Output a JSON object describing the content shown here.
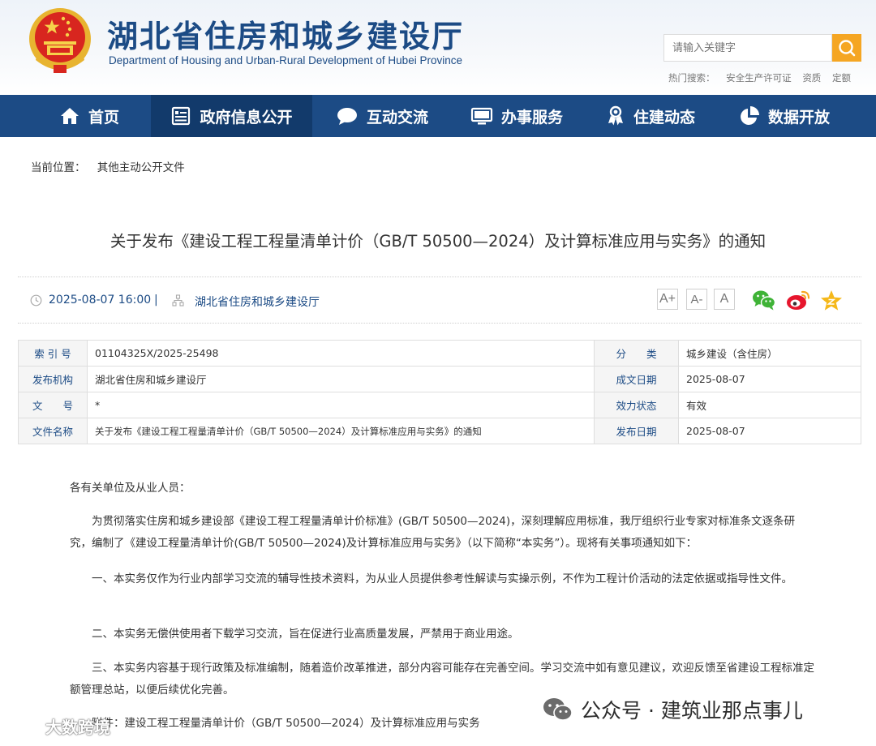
{
  "header": {
    "title": "湖北省住房和城乡建设厅",
    "subtitle": "Department of Housing and Urban-Rural Development of Hubei Province",
    "search_placeholder": "请输入关键字",
    "hot_search_label": "热门搜索：",
    "hot_search_items": [
      "安全生产许可证",
      "资质",
      "定额"
    ]
  },
  "nav": {
    "items": [
      {
        "label": "首页",
        "icon": "home-icon"
      },
      {
        "label": "政府信息公开",
        "icon": "document-list-icon"
      },
      {
        "label": "互动交流",
        "icon": "chat-bubble-icon"
      },
      {
        "label": "办事服务",
        "icon": "monitor-icon"
      },
      {
        "label": "住建动态",
        "icon": "award-person-icon"
      },
      {
        "label": "数据开放",
        "icon": "pie-chart-icon"
      }
    ],
    "active_index": 1
  },
  "breadcrumb": {
    "label": "当前位置：",
    "current": "其他主动公开文件"
  },
  "article": {
    "title": "关于发布《建设工程工程量清单计价（GB/T 50500—2024）及计算标准应用与实务》的通知",
    "date": "2025-08-07 16:00",
    "separator": "|",
    "publisher": "湖北省住房和城乡建设厅",
    "font_sizes": [
      "A+",
      "A-",
      "A"
    ]
  },
  "info_table": {
    "rows": [
      {
        "label1": "索 引 号",
        "value1": "01104325X/2025-25498",
        "label2": "分　　类",
        "value2": "城乡建设（含住房）"
      },
      {
        "label1": "发布机构",
        "value1": "湖北省住房和城乡建设厅",
        "label2": "成文日期",
        "value2": "2025-08-07"
      },
      {
        "label1": "文　　号",
        "value1": "*",
        "label2": "效力状态",
        "value2": "有效"
      },
      {
        "label1": "文件名称",
        "value1": "关于发布《建设工程工程量清单计价（GB/T 50500—2024）及计算标准应用与实务》的通知",
        "label2": "发布日期",
        "value2": "2025-08-07"
      }
    ]
  },
  "body": {
    "salutation": "各有关单位及从业人员：",
    "p1": "为贯彻落实住房和城乡建设部《建设工程工程量清单计价标准》(GB/T 50500—2024)，深刻理解应用标准，我厅组织行业专家对标准条文逐条研究，编制了《建设工程量清单计价(GB/T 50500—2024)及计算标准应用与实务》（以下简称“本实务”）。现将有关事项通知如下：",
    "p2": "一、本实务仅作为行业内部学习交流的辅导性技术资料，为从业人员提供参考性解读与实操示例，不作为工程计价活动的法定依据或指导性文件。",
    "p3": "二、本实务无偿供使用者下载学习交流，旨在促进行业高质量发展，严禁用于商业用途。",
    "p4": "三、本实务内容基于现行政策及标准编制，随着造价改革推进，部分内容可能存在完善空间。学习交流中如有意见建议，欢迎反馈至省建设工程标准定额管理总站，以便后续优化完善。",
    "attachment": "附件：建设工程工程量清单计价（GB/T 50500—2024）及计算标准应用与实务"
  },
  "watermark": {
    "right": "公众号 · 建筑业那点事儿",
    "left": "大数跨境"
  },
  "colors": {
    "brand_blue": "#1c4b85",
    "nav_active": "#123a6b",
    "search_orange": "#f5a623"
  }
}
